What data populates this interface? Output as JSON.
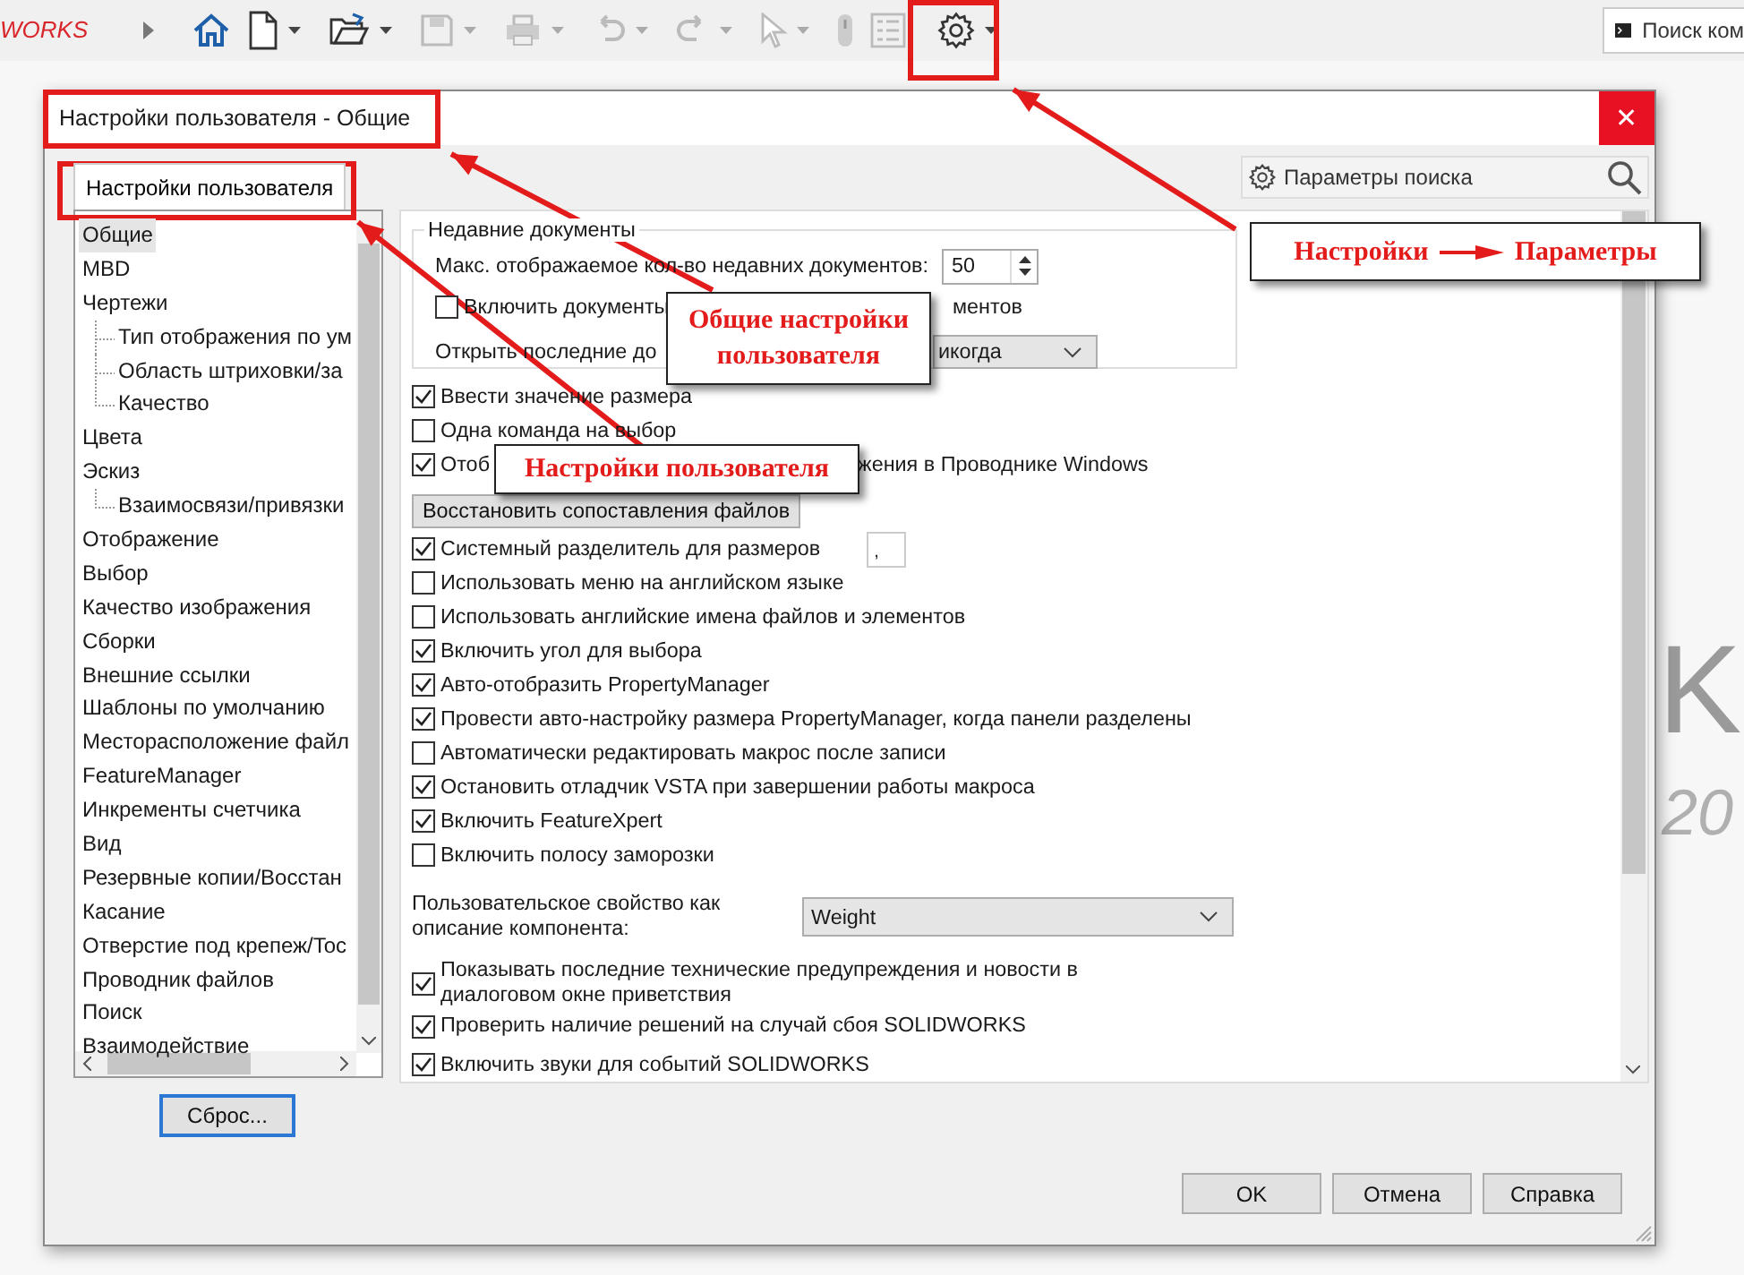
{
  "app_toolbar": {
    "brand": "WORKS",
    "search_placeholder": "Поиск ком"
  },
  "splash": [
    "K",
    "20"
  ],
  "dialog": {
    "title": "Настройки пользователя - Общие",
    "close": "✕",
    "tab": {
      "label": "Настройки пользователя",
      "selected": true
    },
    "search_placeholder": "Параметры поиска",
    "tree": [
      {
        "label": "Общие",
        "selected": true
      },
      {
        "label": "MBD",
        "selected": false
      },
      {
        "label": "Чертежи",
        "selected": false,
        "children": [
          {
            "label": "Тип отображения по ум",
            "selected": false
          },
          {
            "label": "Область штриховки/за",
            "selected": false
          },
          {
            "label": "Качество",
            "selected": false
          }
        ]
      },
      {
        "label": "Цвета",
        "selected": false
      },
      {
        "label": "Эскиз",
        "selected": false,
        "children": [
          {
            "label": "Взаимосвязи/привязки",
            "selected": false
          }
        ]
      },
      {
        "label": "Отображение",
        "selected": false
      },
      {
        "label": "Выбор",
        "selected": false
      },
      {
        "label": "Качество изображения",
        "selected": false
      },
      {
        "label": "Сборки",
        "selected": false
      },
      {
        "label": "Внешние ссылки",
        "selected": false
      },
      {
        "label": "Шаблоны по умолчанию",
        "selected": false
      },
      {
        "label": "Месторасположение файл",
        "selected": false
      },
      {
        "label": "FeatureManager",
        "selected": false
      },
      {
        "label": "Инкременты счетчика",
        "selected": false
      },
      {
        "label": "Вид",
        "selected": false
      },
      {
        "label": "Резервные копии/Восстан",
        "selected": false
      },
      {
        "label": "Касание",
        "selected": false
      },
      {
        "label": "Отверстие под крепеж/Toc",
        "selected": false
      },
      {
        "label": "Проводник файлов",
        "selected": false
      },
      {
        "label": "Поиск",
        "selected": false
      },
      {
        "label": "Взаимодействие",
        "selected": false
      }
    ],
    "reset_button": "Сброс...",
    "recent_group": {
      "title": "Недавние документы",
      "max_label": "Макс. отображаемое кол-во недавних документов:",
      "max_value": "50",
      "include": {
        "label_start": "Включить документы",
        "label_end": "ментов",
        "checked": false
      },
      "open_label": "Открыть последние до",
      "open_value": "икогда"
    },
    "options": [
      {
        "kind": "checkbox",
        "label": "Ввести значение размера",
        "checked": true
      },
      {
        "kind": "checkbox",
        "label": "Одна команда на выбор",
        "checked": false
      },
      {
        "kind": "split_checkbox",
        "label_start": "Отоб",
        "label_end": "жения в Проводнике Windows",
        "checked": true
      },
      {
        "kind": "button",
        "label": "Восстановить сопоставления файлов"
      },
      {
        "kind": "checkbox_field",
        "label": "Системный разделитель для размеров",
        "checked": true,
        "value": ","
      },
      {
        "kind": "checkbox",
        "label": "Использовать меню на английском языке",
        "checked": false
      },
      {
        "kind": "checkbox",
        "label": "Использовать английские имена файлов и элементов",
        "checked": false
      },
      {
        "kind": "checkbox",
        "label": "Включить угол для выбора",
        "checked": true
      },
      {
        "kind": "checkbox",
        "label": "Авто-отобразить PropertyManager",
        "checked": true
      },
      {
        "kind": "checkbox",
        "label": "Провести авто-настройку размера PropertyManager, когда панели разделены",
        "checked": true
      },
      {
        "kind": "checkbox",
        "label": "Автоматически редактировать макрос после записи",
        "checked": false
      },
      {
        "kind": "checkbox",
        "label": "Остановить отладчик VSTA при завершении работы макроса",
        "checked": true
      },
      {
        "kind": "checkbox",
        "label": "Включить FeatureXpert",
        "checked": true
      },
      {
        "kind": "checkbox",
        "label": "Включить полосу заморозки",
        "checked": false
      },
      {
        "kind": "select",
        "label": "Пользовательское свойство как описание компонента:",
        "value": "Weight"
      },
      {
        "kind": "checkbox",
        "label": "Показывать последние технические предупреждения и новости в диалоговом окне приветствия",
        "checked": true
      },
      {
        "kind": "checkbox",
        "label": "Проверить наличие решений на случай сбоя SOLIDWORKS",
        "checked": true
      },
      {
        "kind": "checkbox",
        "label": "Включить звуки для событий SOLIDWORKS",
        "checked": true
      }
    ],
    "buttons": [
      "OK",
      "Отмена",
      "Справка"
    ]
  },
  "callouts": [
    {
      "kind": "arrow_label",
      "start": "Настройки",
      "end": "Параметры"
    },
    {
      "kind": "text",
      "text": "Общие настройки пользователя"
    },
    {
      "kind": "text",
      "text": "Настройки пользователя"
    }
  ]
}
